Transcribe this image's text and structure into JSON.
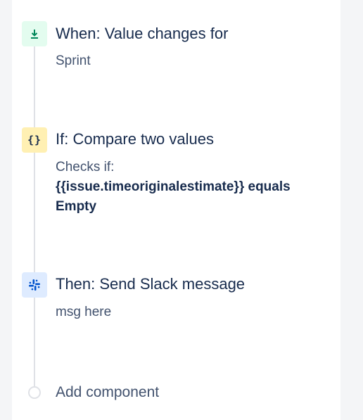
{
  "trigger": {
    "icon": "download-arrow-icon",
    "icon_color": "#00875a",
    "title": "When: Value changes for",
    "detail": "Sprint"
  },
  "condition": {
    "icon": "curly-braces-icon",
    "glyph": "{}",
    "title": "If: Compare two values",
    "detail_label": "Checks if:",
    "detail_expression": "{{issue.timeoriginalestimate}} equals Empty"
  },
  "action": {
    "icon": "slack-icon",
    "icon_color": "#0052cc",
    "title": "Then: Send Slack message",
    "detail": "msg here"
  },
  "add_component": {
    "label": "Add component"
  }
}
